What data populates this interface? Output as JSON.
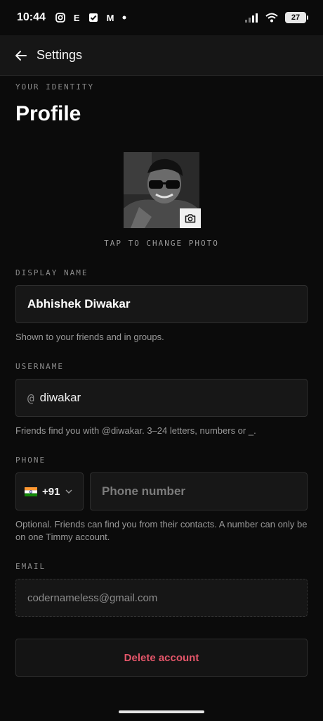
{
  "status_bar": {
    "time": "10:44",
    "notification_icons": [
      "instagram-icon",
      "e-app-icon",
      "check-app-icon",
      "gmail-icon",
      "dot-icon"
    ],
    "notif_letter_e": "E",
    "notif_letter_m": "M",
    "battery": "27"
  },
  "app_bar": {
    "back_icon": "arrow-left-icon",
    "title": "Settings"
  },
  "profile": {
    "section_caption": "YOUR IDENTITY",
    "title": "Profile",
    "change_photo": "TAP TO CHANGE PHOTO"
  },
  "display_name": {
    "label": "DISPLAY NAME",
    "value": "Abhishek Diwakar",
    "helper": "Shown to your friends and in groups."
  },
  "username": {
    "label": "USERNAME",
    "prefix": "@",
    "value": "diwakar",
    "helper": "Friends find you with @diwakar. 3–24 letters, numbers or _."
  },
  "phone": {
    "label": "PHONE",
    "country_code": "+91",
    "placeholder": "Phone number",
    "helper": "Optional. Friends can find you from their contacts. A number can only be on one Timmy account."
  },
  "email": {
    "label": "EMAIL",
    "value": "codernameless@gmail.com"
  },
  "actions": {
    "delete_label": "Delete account"
  },
  "colors": {
    "background": "#0b0b0b",
    "danger": "#e5566a"
  }
}
